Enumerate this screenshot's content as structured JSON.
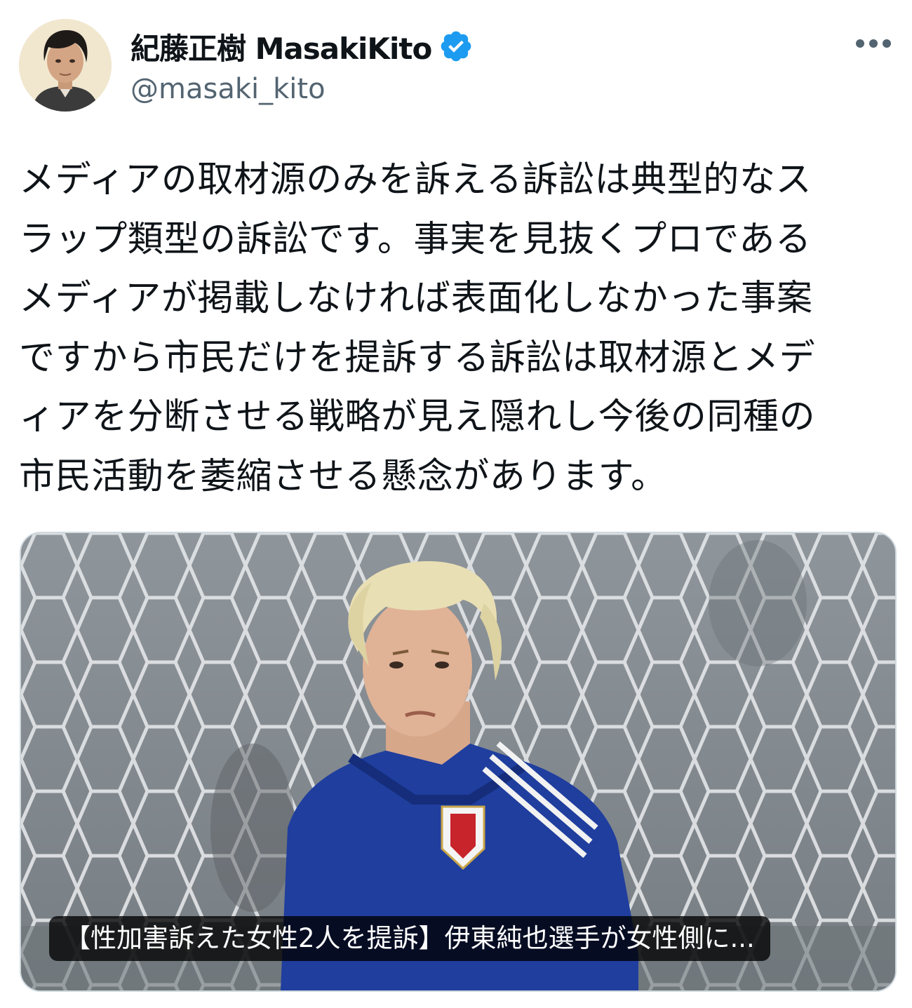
{
  "author": {
    "display_name": "紀藤正樹 MasakiKito",
    "handle": "@masaki_kito",
    "verified": true,
    "avatar_icon": "profile-photo",
    "verified_icon": "verified-badge-icon",
    "more_icon": "more-horizontal-icon",
    "badge_color": "#1d9bf0"
  },
  "tweet": {
    "lines": [
      "メディアの取材源のみを訴える訴訟は典型的なス",
      "ラップ類型の訴訟です。事実を見抜くプロである",
      "メディアが掲載しなければ表面化しなかった事案",
      "ですから市民だけを提訴する訴訟は取材源とメデ",
      "ィアを分断させる戦略が見え隠れし今後の同種の",
      "市民活動を萎縮させる懸念があります。"
    ]
  },
  "media": {
    "link_title": "【性加害訴えた女性2人を提訴】伊東純也選手が女性側に...",
    "image_subject": "soccer-player-photo"
  }
}
